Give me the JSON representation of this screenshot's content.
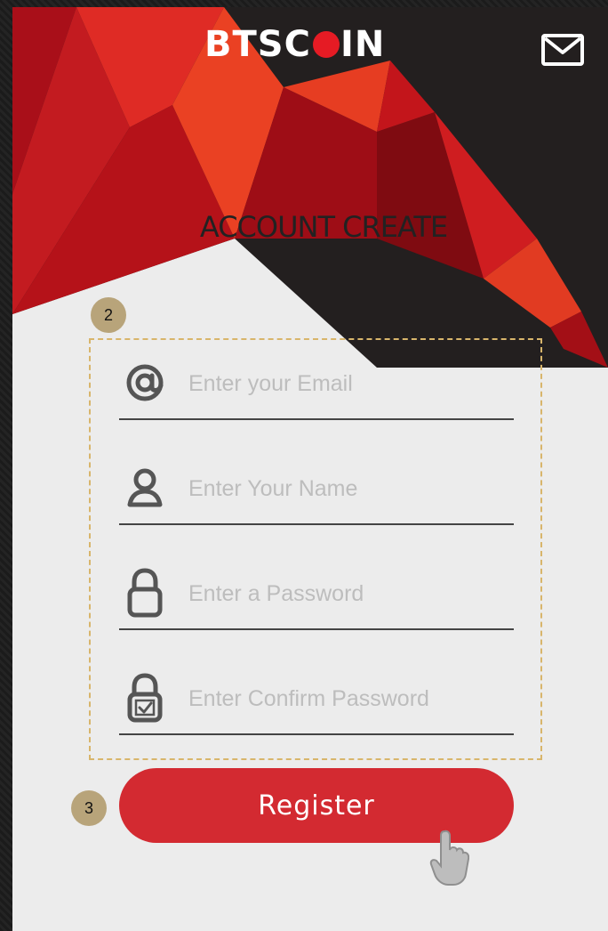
{
  "app": {
    "brand_prefix": "BTSC",
    "brand_suffix": "IN",
    "title": "ACCOUNT CREATE"
  },
  "callouts": {
    "form_group": "2",
    "register_step": "3"
  },
  "form": {
    "fields": [
      {
        "name": "email",
        "icon": "at-icon",
        "placeholder": "Enter your Email",
        "value": ""
      },
      {
        "name": "name",
        "icon": "user-icon",
        "placeholder": "Enter Your Name",
        "value": ""
      },
      {
        "name": "password",
        "icon": "lock-icon",
        "placeholder": "Enter a Password",
        "value": ""
      },
      {
        "name": "confirm_password",
        "icon": "lock-check-icon",
        "placeholder": "Enter Confirm Password",
        "value": ""
      }
    ],
    "register_label": "Register"
  },
  "colors": {
    "accent_red": "#d32a31",
    "header_black": "#231f1f",
    "highlight_tan": "#b8a47a",
    "dashed_border": "#d8b56b"
  }
}
